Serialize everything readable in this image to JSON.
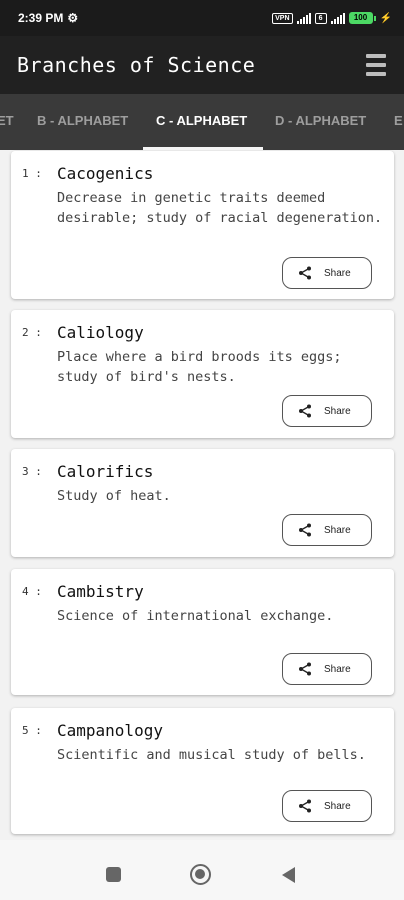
{
  "status_bar": {
    "time": "2:39 PM",
    "vpn": "VPN",
    "wifi": "6",
    "battery": "100"
  },
  "app_bar": {
    "title": "Branches of Science"
  },
  "tabs": [
    {
      "label": "ET",
      "active": false
    },
    {
      "label": "B - ALPHABET",
      "active": false
    },
    {
      "label": "C - ALPHABET",
      "active": true
    },
    {
      "label": "D - ALPHABET",
      "active": false
    },
    {
      "label": "E",
      "active": false
    }
  ],
  "entries": [
    {
      "number": "1 :",
      "title": "Cacogenics",
      "description": "Decrease in genetic traits deemed desirable; study of racial degeneration.",
      "share_label": "Share"
    },
    {
      "number": "2 :",
      "title": "Caliology",
      "description": "Place where a bird broods its eggs; study of bird's nests.",
      "share_label": "Share"
    },
    {
      "number": "3 :",
      "title": "Calorifics",
      "description": "Study of heat.",
      "share_label": "Share"
    },
    {
      "number": "4 :",
      "title": "Cambistry",
      "description": "Science of international exchange.",
      "share_label": "Share"
    },
    {
      "number": "5 :",
      "title": "Campanology",
      "description": "Scientific and musical study of bells.",
      "share_label": "Share"
    }
  ],
  "icons": {
    "share": "share-icon",
    "menu": "menu-icon",
    "gear": "gear-icon"
  },
  "colors": {
    "app_bar": "#212121",
    "tab_bar": "#3a3a3a",
    "active_tab": "#ffffff",
    "inactive_tab": "#9e9e9e"
  }
}
